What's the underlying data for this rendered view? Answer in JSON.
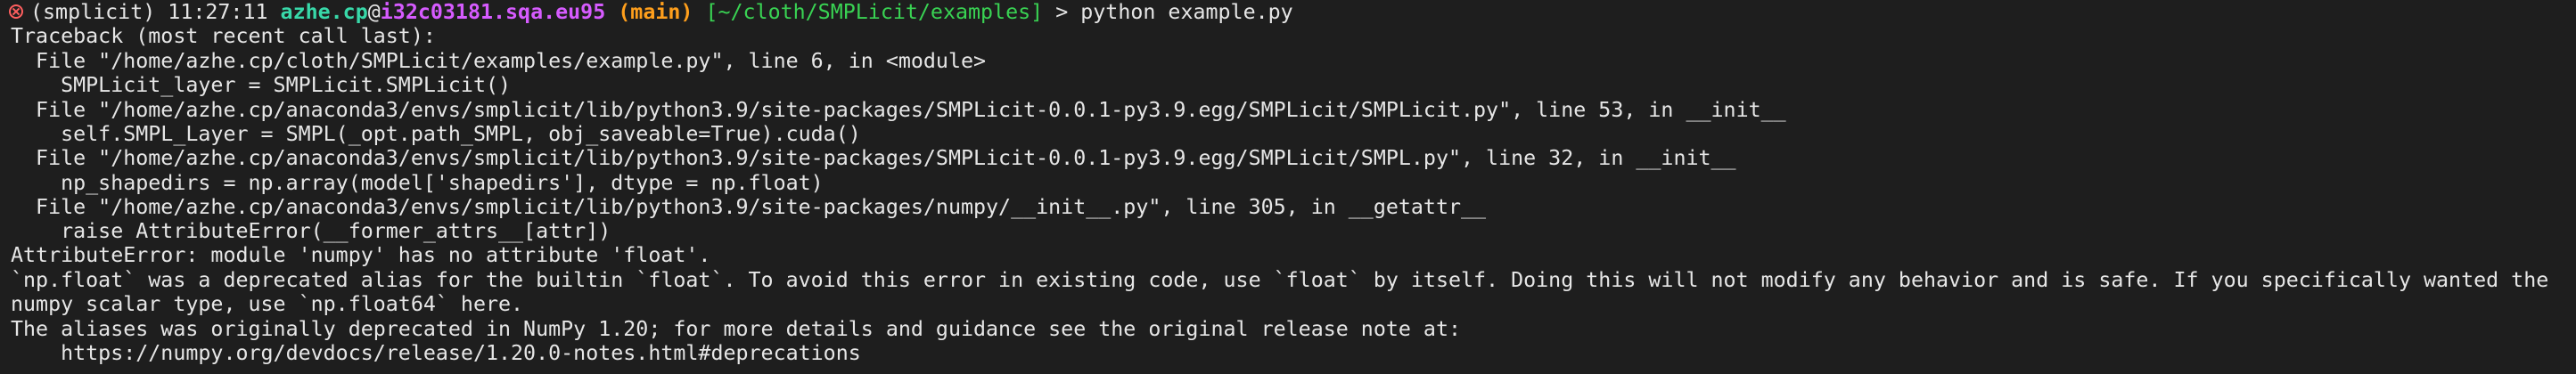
{
  "terminal": {
    "prompt": {
      "status_icon": "error-x-circle-icon",
      "env": "(smplicit)",
      "time": "11:27:11",
      "user": "azhe.cp",
      "at": "@",
      "host": "i32c03181.sqa.eu95",
      "branch": "(main)",
      "path": "[~/cloth/SMPLicit/examples]",
      "symbol": ">",
      "command": "python example.py"
    },
    "lines": [
      "Traceback (most recent call last):",
      "  File \"/home/azhe.cp/cloth/SMPLicit/examples/example.py\", line 6, in <module>",
      "    SMPLicit_layer = SMPLicit.SMPLicit()",
      "  File \"/home/azhe.cp/anaconda3/envs/smplicit/lib/python3.9/site-packages/SMPLicit-0.0.1-py3.9.egg/SMPLicit/SMPLicit.py\", line 53, in __init__",
      "    self.SMPL_Layer = SMPL(_opt.path_SMPL, obj_saveable=True).cuda()",
      "  File \"/home/azhe.cp/anaconda3/envs/smplicit/lib/python3.9/site-packages/SMPLicit-0.0.1-py3.9.egg/SMPLicit/SMPL.py\", line 32, in __init__",
      "    np_shapedirs = np.array(model['shapedirs'], dtype = np.float)",
      "  File \"/home/azhe.cp/anaconda3/envs/smplicit/lib/python3.9/site-packages/numpy/__init__.py\", line 305, in __getattr__",
      "    raise AttributeError(__former_attrs__[attr])",
      "AttributeError: module 'numpy' has no attribute 'float'.",
      "`np.float` was a deprecated alias for the builtin `float`. To avoid this error in existing code, use `float` by itself. Doing this will not modify any behavior and is safe. If you specifically wanted the",
      "numpy scalar type, use `np.float64` here.",
      "The aliases was originally deprecated in NumPy 1.20; for more details and guidance see the original release note at:",
      "    https://numpy.org/devdocs/release/1.20.0-notes.html#deprecations"
    ]
  }
}
